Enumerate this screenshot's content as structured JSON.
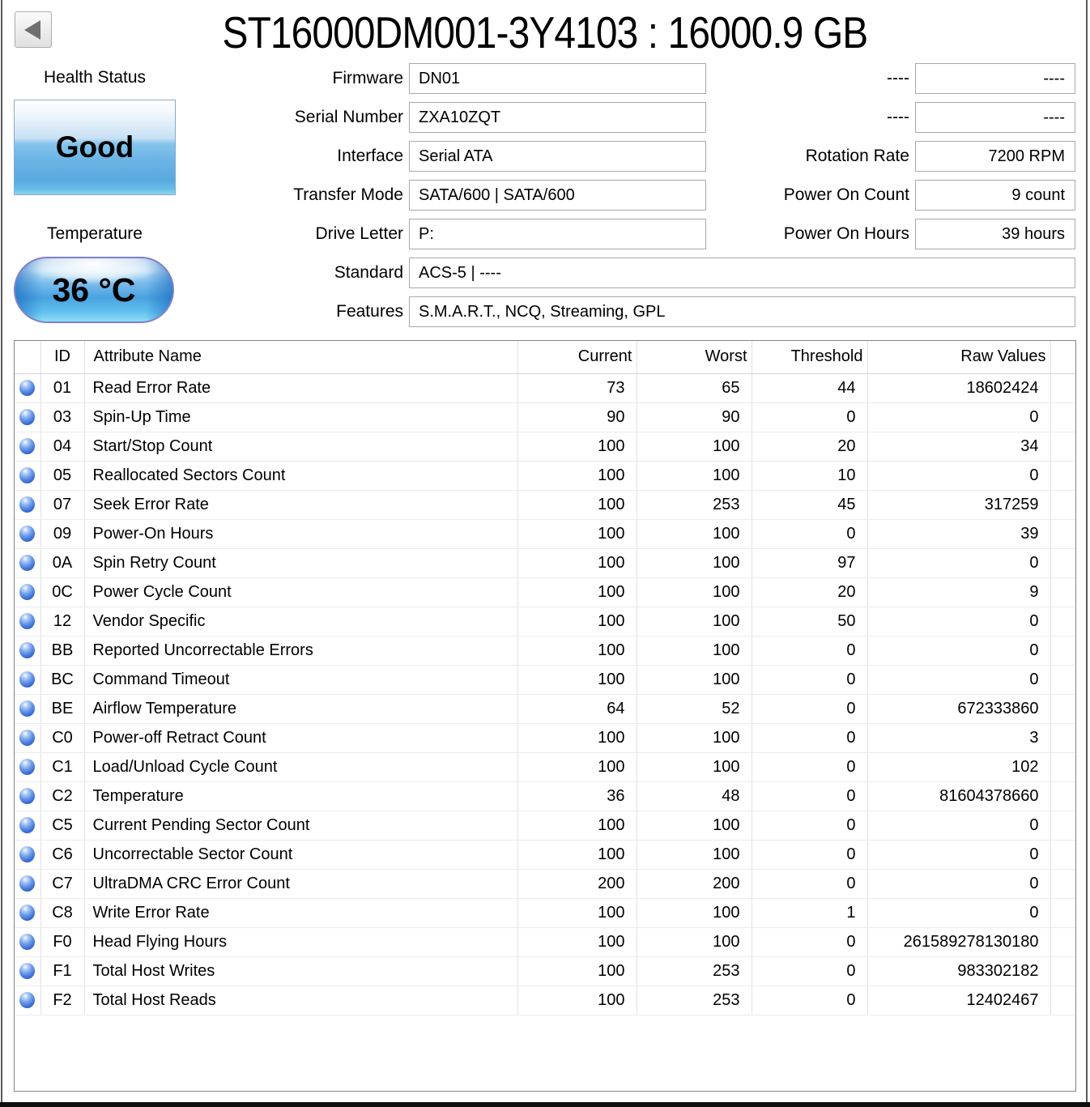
{
  "window": {
    "title": "ST16000DM001-3Y4103 : 16000.9 GB"
  },
  "health": {
    "label": "Health Status",
    "status": "Good"
  },
  "temperature": {
    "label": "Temperature",
    "value": "36 °C"
  },
  "info_left": [
    {
      "label": "Firmware",
      "value": "DN01"
    },
    {
      "label": "Serial Number",
      "value": "ZXA10ZQT"
    },
    {
      "label": "Interface",
      "value": "Serial ATA"
    },
    {
      "label": "Transfer Mode",
      "value": "SATA/600 | SATA/600"
    },
    {
      "label": "Drive Letter",
      "value": "P:"
    },
    {
      "label": "Standard",
      "value": "ACS-5 | ----"
    },
    {
      "label": "Features",
      "value": "S.M.A.R.T., NCQ, Streaming, GPL"
    }
  ],
  "info_right": [
    {
      "label": "----",
      "value": "----"
    },
    {
      "label": "----",
      "value": "----"
    },
    {
      "label": "Rotation Rate",
      "value": "7200 RPM"
    },
    {
      "label": "Power On Count",
      "value": "9 count"
    },
    {
      "label": "Power On Hours",
      "value": "39 hours"
    }
  ],
  "smart_table": {
    "headers": {
      "id": "ID",
      "name": "Attribute Name",
      "current": "Current",
      "worst": "Worst",
      "threshold": "Threshold",
      "raw": "Raw Values"
    },
    "status_dot_color": "#3a6ed2",
    "rows": [
      {
        "id": "01",
        "name": "Read Error Rate",
        "current": "73",
        "worst": "65",
        "threshold": "44",
        "raw": "18602424"
      },
      {
        "id": "03",
        "name": "Spin-Up Time",
        "current": "90",
        "worst": "90",
        "threshold": "0",
        "raw": "0"
      },
      {
        "id": "04",
        "name": "Start/Stop Count",
        "current": "100",
        "worst": "100",
        "threshold": "20",
        "raw": "34"
      },
      {
        "id": "05",
        "name": "Reallocated Sectors Count",
        "current": "100",
        "worst": "100",
        "threshold": "10",
        "raw": "0"
      },
      {
        "id": "07",
        "name": "Seek Error Rate",
        "current": "100",
        "worst": "253",
        "threshold": "45",
        "raw": "317259"
      },
      {
        "id": "09",
        "name": "Power-On Hours",
        "current": "100",
        "worst": "100",
        "threshold": "0",
        "raw": "39"
      },
      {
        "id": "0A",
        "name": "Spin Retry Count",
        "current": "100",
        "worst": "100",
        "threshold": "97",
        "raw": "0"
      },
      {
        "id": "0C",
        "name": "Power Cycle Count",
        "current": "100",
        "worst": "100",
        "threshold": "20",
        "raw": "9"
      },
      {
        "id": "12",
        "name": "Vendor Specific",
        "current": "100",
        "worst": "100",
        "threshold": "50",
        "raw": "0"
      },
      {
        "id": "BB",
        "name": "Reported Uncorrectable Errors",
        "current": "100",
        "worst": "100",
        "threshold": "0",
        "raw": "0"
      },
      {
        "id": "BC",
        "name": "Command Timeout",
        "current": "100",
        "worst": "100",
        "threshold": "0",
        "raw": "0"
      },
      {
        "id": "BE",
        "name": "Airflow Temperature",
        "current": "64",
        "worst": "52",
        "threshold": "0",
        "raw": "672333860"
      },
      {
        "id": "C0",
        "name": "Power-off Retract Count",
        "current": "100",
        "worst": "100",
        "threshold": "0",
        "raw": "3"
      },
      {
        "id": "C1",
        "name": "Load/Unload Cycle Count",
        "current": "100",
        "worst": "100",
        "threshold": "0",
        "raw": "102"
      },
      {
        "id": "C2",
        "name": "Temperature",
        "current": "36",
        "worst": "48",
        "threshold": "0",
        "raw": "81604378660"
      },
      {
        "id": "C5",
        "name": "Current Pending Sector Count",
        "current": "100",
        "worst": "100",
        "threshold": "0",
        "raw": "0"
      },
      {
        "id": "C6",
        "name": "Uncorrectable Sector Count",
        "current": "100",
        "worst": "100",
        "threshold": "0",
        "raw": "0"
      },
      {
        "id": "C7",
        "name": "UltraDMA CRC Error Count",
        "current": "200",
        "worst": "200",
        "threshold": "0",
        "raw": "0"
      },
      {
        "id": "C8",
        "name": "Write Error Rate",
        "current": "100",
        "worst": "100",
        "threshold": "1",
        "raw": "0"
      },
      {
        "id": "F0",
        "name": "Head Flying Hours",
        "current": "100",
        "worst": "100",
        "threshold": "0",
        "raw": "261589278130180"
      },
      {
        "id": "F1",
        "name": "Total Host Writes",
        "current": "100",
        "worst": "253",
        "threshold": "0",
        "raw": "983302182"
      },
      {
        "id": "F2",
        "name": "Total Host Reads",
        "current": "100",
        "worst": "253",
        "threshold": "0",
        "raw": "12402467"
      }
    ]
  },
  "colors": {
    "health_good_fill": "#5aa9de",
    "temp_pill_fill": "#55a8e2"
  }
}
